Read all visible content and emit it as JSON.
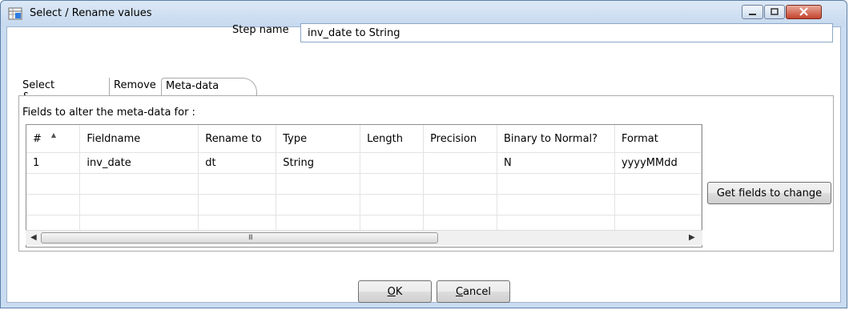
{
  "window": {
    "title": "Select / Rename values"
  },
  "step": {
    "label": "Step name",
    "value": "inv_date to String"
  },
  "tabs": [
    {
      "label": "Select & Alter"
    },
    {
      "label": "Remove"
    },
    {
      "label": "Meta-data",
      "selected": true
    }
  ],
  "metadata": {
    "panel_label": "Fields to alter the meta-data for :",
    "columns": [
      "#",
      "Fieldname",
      "Rename to",
      "Type",
      "Length",
      "Precision",
      "Binary to Normal?",
      "Format"
    ],
    "rows": [
      [
        "1",
        "inv_date",
        "dt",
        "String",
        "",
        "",
        "N",
        "yyyyMMdd"
      ],
      [
        "",
        "",
        "",
        "",
        "",
        "",
        "",
        ""
      ],
      [
        "",
        "",
        "",
        "",
        "",
        "",
        "",
        ""
      ],
      [
        "",
        "",
        "",
        "",
        "",
        "",
        "",
        ""
      ]
    ],
    "scrollbar_grip": "III"
  },
  "buttons": {
    "get_fields": "Get fields to change",
    "ok_mnemonic": "O",
    "ok_rest": "K",
    "cancel_mnemonic": "C",
    "cancel_rest": "ancel"
  },
  "colors": {
    "frame": "#c9dcf1",
    "close_button": "#c4432c"
  }
}
